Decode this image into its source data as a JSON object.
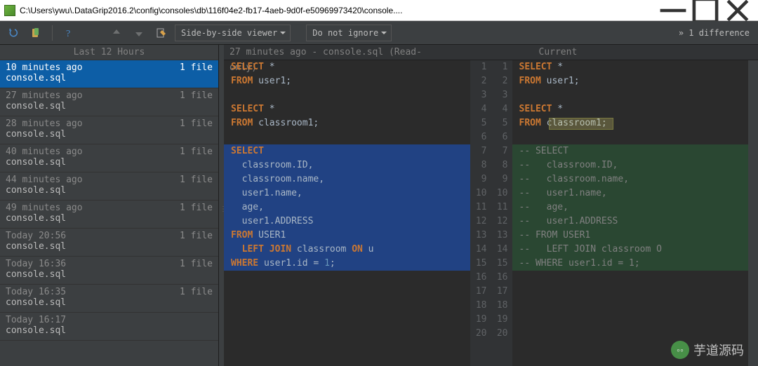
{
  "window": {
    "title": "C:\\Users\\ywu\\.DataGrip2016.2\\config\\consoles\\db\\116f04e2-fb17-4aeb-9d0f-e50969973420\\console...."
  },
  "toolbar": {
    "viewer_mode": "Side-by-side viewer",
    "ignore_mode": "Do not ignore",
    "diff_count": "» 1 difference"
  },
  "history": {
    "header": "Last 12 Hours",
    "items": [
      {
        "time": "10 minutes ago",
        "count": "1 file",
        "file": "console.sql",
        "selected": true
      },
      {
        "time": "27 minutes ago",
        "count": "1 file",
        "file": "console.sql"
      },
      {
        "time": "28 minutes ago",
        "count": "1 file",
        "file": "console.sql"
      },
      {
        "time": "40 minutes ago",
        "count": "1 file",
        "file": "console.sql"
      },
      {
        "time": "44 minutes ago",
        "count": "1 file",
        "file": "console.sql"
      },
      {
        "time": "49 minutes ago",
        "count": "1 file",
        "file": "console.sql"
      },
      {
        "time": "Today 20:56",
        "count": "1 file",
        "file": "console.sql"
      },
      {
        "time": "Today 16:36",
        "count": "1 file",
        "file": "console.sql"
      },
      {
        "time": "Today 16:35",
        "count": "1 file",
        "file": "console.sql"
      },
      {
        "time": "Today 16:17",
        "count": "",
        "file": "console.sql"
      }
    ]
  },
  "diff": {
    "left_title": "27 minutes ago - console.sql (Read-only)",
    "right_title": "Current",
    "line_numbers": [
      "1",
      "2",
      "3",
      "4",
      "5",
      "6",
      "7",
      "8",
      "9",
      "10",
      "11",
      "12",
      "13",
      "14",
      "15",
      "16",
      "17",
      "18",
      "19",
      "20"
    ],
    "left_lines": [
      {
        "tokens": [
          {
            "t": "SELECT",
            "c": "kw"
          },
          {
            "t": " "
          },
          {
            "t": "*",
            "c": "star"
          }
        ]
      },
      {
        "tokens": [
          {
            "t": "FROM",
            "c": "kw"
          },
          {
            "t": " user1;",
            "c": "id"
          }
        ]
      },
      {
        "tokens": []
      },
      {
        "tokens": [
          {
            "t": "SELECT",
            "c": "kw"
          },
          {
            "t": " "
          },
          {
            "t": "*",
            "c": "star"
          }
        ]
      },
      {
        "tokens": [
          {
            "t": "FROM",
            "c": "kw"
          },
          {
            "t": " classroom1;",
            "c": "id"
          }
        ]
      },
      {
        "tokens": []
      },
      {
        "tokens": [
          {
            "t": "SELECT",
            "c": "kw"
          }
        ],
        "sel": "blue"
      },
      {
        "tokens": [
          {
            "t": "  classroom.ID,",
            "c": "id"
          }
        ],
        "sel": "blue"
      },
      {
        "tokens": [
          {
            "t": "  classroom.name,",
            "c": "id"
          }
        ],
        "sel": "blue"
      },
      {
        "tokens": [
          {
            "t": "  user1.name,",
            "c": "id"
          }
        ],
        "sel": "blue"
      },
      {
        "tokens": [
          {
            "t": "  age,",
            "c": "id"
          }
        ],
        "sel": "blue"
      },
      {
        "tokens": [
          {
            "t": "  user1.ADDRESS",
            "c": "id"
          }
        ],
        "sel": "blue"
      },
      {
        "tokens": [
          {
            "t": "FROM",
            "c": "kw"
          },
          {
            "t": " USER1",
            "c": "id"
          }
        ],
        "sel": "blue"
      },
      {
        "tokens": [
          {
            "t": "  ",
            "c": "id"
          },
          {
            "t": "LEFT JOIN",
            "c": "kw"
          },
          {
            "t": " classroom ",
            "c": "id"
          },
          {
            "t": "ON",
            "c": "kw"
          },
          {
            "t": " u",
            "c": "id"
          }
        ],
        "sel": "blue"
      },
      {
        "tokens": [
          {
            "t": "WHERE",
            "c": "kw"
          },
          {
            "t": " user1.id = ",
            "c": "id"
          },
          {
            "t": "1",
            "c": "num"
          },
          {
            "t": ";",
            "c": "id"
          }
        ],
        "sel": "blue"
      }
    ],
    "right_lines": [
      {
        "tokens": [
          {
            "t": "SELECT",
            "c": "kw"
          },
          {
            "t": " "
          },
          {
            "t": "*",
            "c": "star"
          }
        ]
      },
      {
        "tokens": [
          {
            "t": "FROM",
            "c": "kw"
          },
          {
            "t": " user1;",
            "c": "id"
          }
        ]
      },
      {
        "tokens": []
      },
      {
        "tokens": [
          {
            "t": "SELECT",
            "c": "kw"
          },
          {
            "t": " "
          },
          {
            "t": "*",
            "c": "star"
          }
        ]
      },
      {
        "tokens": [
          {
            "t": "FROM",
            "c": "kw"
          },
          {
            "t": " ",
            "c": "id"
          },
          {
            "t": "classroom1",
            "c": "id"
          },
          {
            "t": ";",
            "c": "id"
          }
        ],
        "hl": true
      },
      {
        "tokens": []
      },
      {
        "tokens": [
          {
            "t": "-- SELECT",
            "c": "cm"
          }
        ],
        "sel": "green"
      },
      {
        "tokens": [
          {
            "t": "--   classroom.ID,",
            "c": "cm"
          }
        ],
        "sel": "green"
      },
      {
        "tokens": [
          {
            "t": "--   classroom.name,",
            "c": "cm"
          }
        ],
        "sel": "green"
      },
      {
        "tokens": [
          {
            "t": "--   user1.name,",
            "c": "cm"
          }
        ],
        "sel": "green"
      },
      {
        "tokens": [
          {
            "t": "--   age,",
            "c": "cm"
          }
        ],
        "sel": "green"
      },
      {
        "tokens": [
          {
            "t": "--   user1.ADDRESS",
            "c": "cm"
          }
        ],
        "sel": "green"
      },
      {
        "tokens": [
          {
            "t": "-- FROM USER1",
            "c": "cm"
          }
        ],
        "sel": "green"
      },
      {
        "tokens": [
          {
            "t": "--   LEFT JOIN classroom O",
            "c": "cm"
          }
        ],
        "sel": "green"
      },
      {
        "tokens": [
          {
            "t": "-- WHERE user1.id = 1;",
            "c": "cm"
          }
        ],
        "sel": "green"
      },
      {
        "tokens": []
      },
      {
        "tokens": []
      },
      {
        "tokens": []
      },
      {
        "tokens": []
      },
      {
        "tokens": []
      }
    ]
  },
  "watermark": "芋道源码"
}
